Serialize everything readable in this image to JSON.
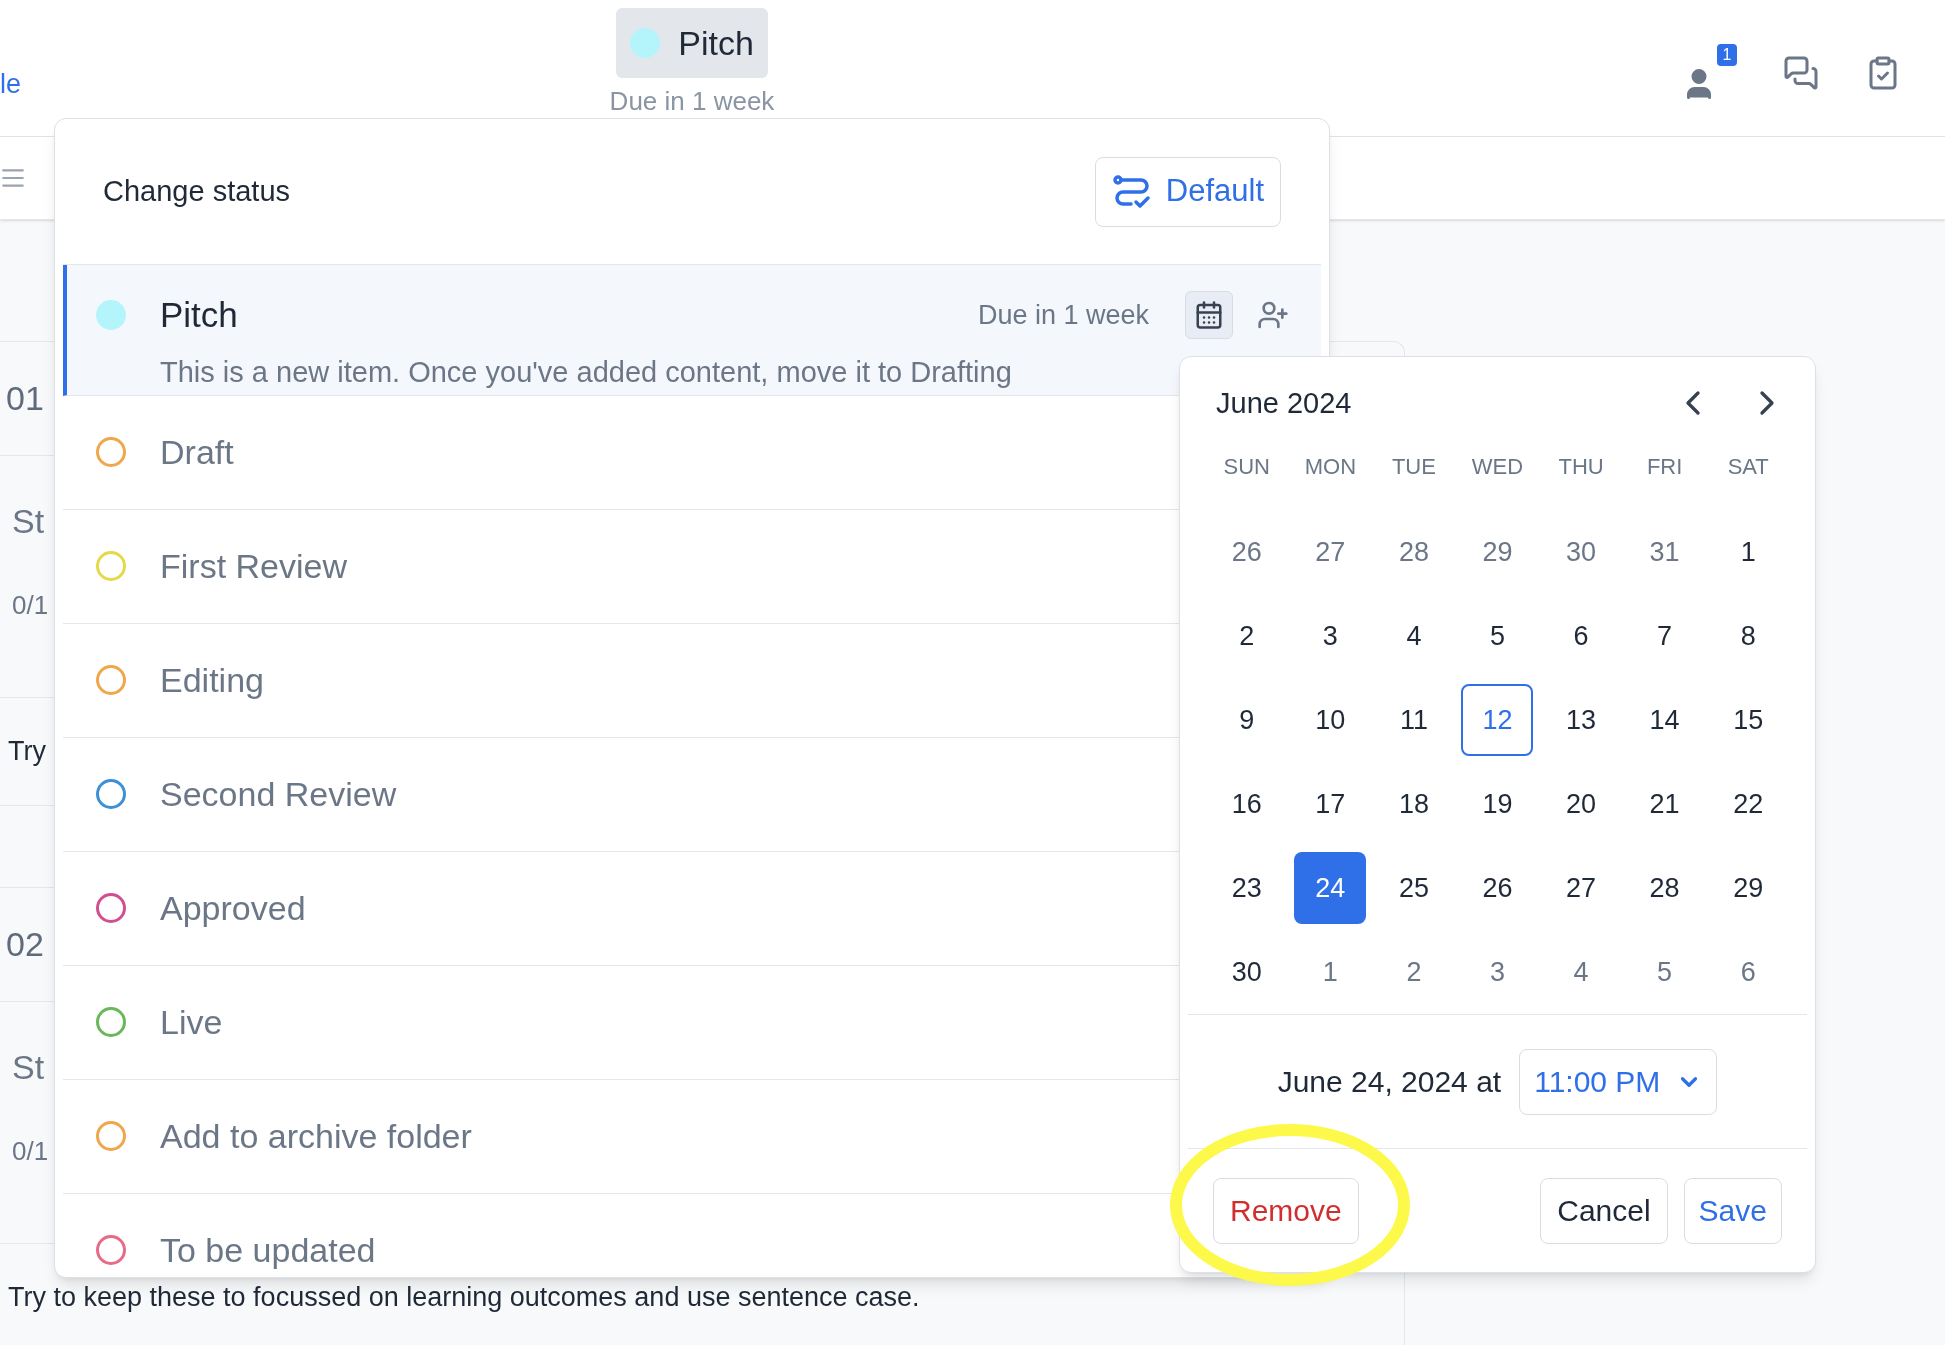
{
  "header": {
    "link": "le",
    "current_status": {
      "label": "Pitch",
      "color": "#b3f5fb",
      "due": "Due in 1 week"
    },
    "people_badge": "1"
  },
  "background_rows": [
    {
      "kind": "number",
      "text": "01"
    },
    {
      "kind": "meta",
      "title": "St",
      "count": "0/1"
    },
    {
      "kind": "hint",
      "text": "Try"
    },
    {
      "kind": "blank"
    },
    {
      "kind": "number",
      "text": "02"
    },
    {
      "kind": "meta",
      "title": "St",
      "count": "0/1"
    },
    {
      "kind": "hint",
      "text": "Try to keep these to focussed on learning outcomes and use sentence case."
    }
  ],
  "status_popover": {
    "title": "Change status",
    "default_button": "Default",
    "statuses": [
      {
        "label": "Pitch",
        "color": "#b3f5fb",
        "selected": true,
        "due": "Due in 1 week",
        "description": "This is a new item. Once you've added content, move it to Drafting",
        "calendar_open": true
      },
      {
        "label": "Draft",
        "color": "#f0a64a",
        "selected": false
      },
      {
        "label": "First Review",
        "color": "#e5d84a",
        "selected": false
      },
      {
        "label": "Editing",
        "color": "#f0a64a",
        "selected": false
      },
      {
        "label": "Second Review",
        "color": "#3d8fd6",
        "selected": false
      },
      {
        "label": "Approved",
        "color": "#d24f8f",
        "selected": false
      },
      {
        "label": "Live",
        "color": "#6ab85a",
        "selected": false
      },
      {
        "label": "Add to archive folder",
        "color": "#f0a64a",
        "selected": false
      },
      {
        "label": "To be updated",
        "color": "#e86a86",
        "selected": false
      }
    ]
  },
  "date_picker": {
    "month": "June 2024",
    "weekdays": [
      "SUN",
      "MON",
      "TUE",
      "WED",
      "THU",
      "FRI",
      "SAT"
    ],
    "weeks": [
      [
        {
          "label": "26",
          "kind": "outside",
          "selected": false
        },
        {
          "label": "27",
          "kind": "outside",
          "selected": false
        },
        {
          "label": "28",
          "kind": "outside",
          "selected": false
        },
        {
          "label": "29",
          "kind": "outside",
          "selected": false
        },
        {
          "label": "30",
          "kind": "outside",
          "selected": false
        },
        {
          "label": "31",
          "kind": "outside",
          "selected": false
        },
        {
          "label": "1",
          "kind": "current",
          "selected": false
        }
      ],
      [
        {
          "label": "2",
          "kind": "current",
          "selected": false
        },
        {
          "label": "3",
          "kind": "current",
          "selected": false
        },
        {
          "label": "4",
          "kind": "current",
          "selected": false
        },
        {
          "label": "5",
          "kind": "current",
          "selected": false
        },
        {
          "label": "6",
          "kind": "current",
          "selected": false
        },
        {
          "label": "7",
          "kind": "current",
          "selected": false
        },
        {
          "label": "8",
          "kind": "current",
          "selected": false
        }
      ],
      [
        {
          "label": "9",
          "kind": "current",
          "selected": false
        },
        {
          "label": "10",
          "kind": "current",
          "selected": false
        },
        {
          "label": "11",
          "kind": "current",
          "selected": false
        },
        {
          "label": "12",
          "kind": "today",
          "selected": false
        },
        {
          "label": "13",
          "kind": "current",
          "selected": false
        },
        {
          "label": "14",
          "kind": "current",
          "selected": false
        },
        {
          "label": "15",
          "kind": "current",
          "selected": false
        }
      ],
      [
        {
          "label": "16",
          "kind": "current",
          "selected": false
        },
        {
          "label": "17",
          "kind": "current",
          "selected": false
        },
        {
          "label": "18",
          "kind": "current",
          "selected": false
        },
        {
          "label": "19",
          "kind": "current",
          "selected": false
        },
        {
          "label": "20",
          "kind": "current",
          "selected": false
        },
        {
          "label": "21",
          "kind": "current",
          "selected": false
        },
        {
          "label": "22",
          "kind": "current",
          "selected": false
        }
      ],
      [
        {
          "label": "23",
          "kind": "current",
          "selected": false
        },
        {
          "label": "24",
          "kind": "current",
          "selected": true
        },
        {
          "label": "25",
          "kind": "current",
          "selected": false
        },
        {
          "label": "26",
          "kind": "current",
          "selected": false
        },
        {
          "label": "27",
          "kind": "current",
          "selected": false
        },
        {
          "label": "28",
          "kind": "current",
          "selected": false
        },
        {
          "label": "29",
          "kind": "current",
          "selected": false
        }
      ],
      [
        {
          "label": "30",
          "kind": "current",
          "selected": false
        },
        {
          "label": "1",
          "kind": "outside",
          "selected": false
        },
        {
          "label": "2",
          "kind": "outside",
          "selected": false
        },
        {
          "label": "3",
          "kind": "outside",
          "selected": false
        },
        {
          "label": "4",
          "kind": "outside",
          "selected": false
        },
        {
          "label": "5",
          "kind": "outside",
          "selected": false
        },
        {
          "label": "6",
          "kind": "outside",
          "selected": false
        }
      ]
    ],
    "summary": "June 24, 2024 at",
    "time": "11:00 PM",
    "remove_button": "Remove",
    "cancel_button": "Cancel",
    "save_button": "Save"
  },
  "annotation": {
    "kind": "ellipse",
    "color": "#fdf94a"
  }
}
